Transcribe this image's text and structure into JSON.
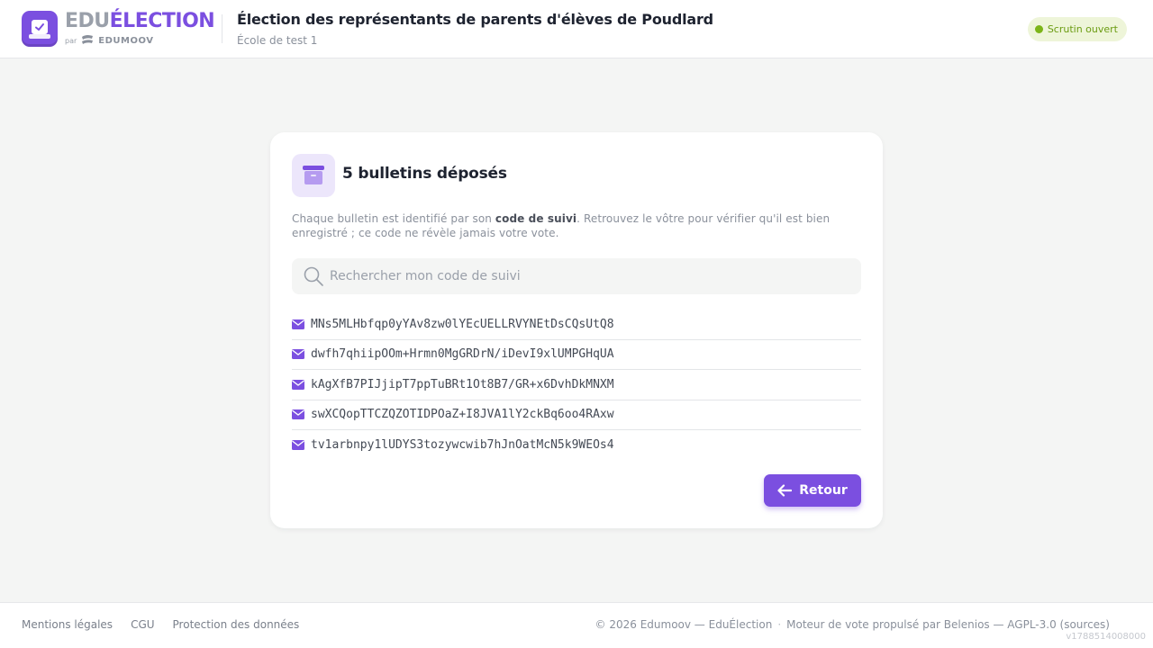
{
  "header": {
    "brand_part1": "EDU",
    "brand_part2": "ÉLECTION",
    "brand_by": "par",
    "brand_company": "EDUMOOV",
    "title": "Élection des représentants de parents d'élèves de Poudlard",
    "subtitle": "École de test 1",
    "status": "Scrutin ouvert"
  },
  "card": {
    "title": "5 bulletins déposés",
    "desc_before": "Chaque bulletin est identifié par son ",
    "desc_bold": "code de suivi",
    "desc_after": ". Retrouvez le vôtre pour vérifier qu'il est bien enregistré ; ce code ne révèle jamais votre vote.",
    "search_placeholder": "Rechercher mon code de suivi",
    "codes": [
      "MNs5MLHbfqp0yYAv8zw0lYEcUELLRVYNEtDsCQsUtQ8",
      "dwfh7qhiipOOm+Hrmn0MgGRDrN/iDevI9xlUMPGHqUA",
      "kAgXfB7PIJjipT7ppTuBRt1Ot8B7/GR+x6DvhDkMNXM",
      "swXCQopTTCZQZOTIDPOaZ+I8JVA1lY2ckBq6oo4RAxw",
      "tv1arbnpy1lUDYS3tozywcwib7hJnOatMcN5k9WEOs4"
    ],
    "back_label": "Retour"
  },
  "footer": {
    "links": [
      "Mentions légales",
      "CGU",
      "Protection des données"
    ],
    "copyright": "© 2026 Edumoov — EduÉlection",
    "separator": "·",
    "engine": "Moteur de vote propulsé par Belenios — AGPL-3.0 (sources)",
    "version": "v1788514008000"
  },
  "colors": {
    "accent": "#7b4fe0",
    "status_green": "#7cb518",
    "background": "#f4f5f4"
  },
  "icons": {
    "logo": "ballot-box-check-icon",
    "card": "archive-box-icon",
    "search": "search-icon",
    "code": "envelope-icon",
    "back": "arrow-left-icon"
  }
}
